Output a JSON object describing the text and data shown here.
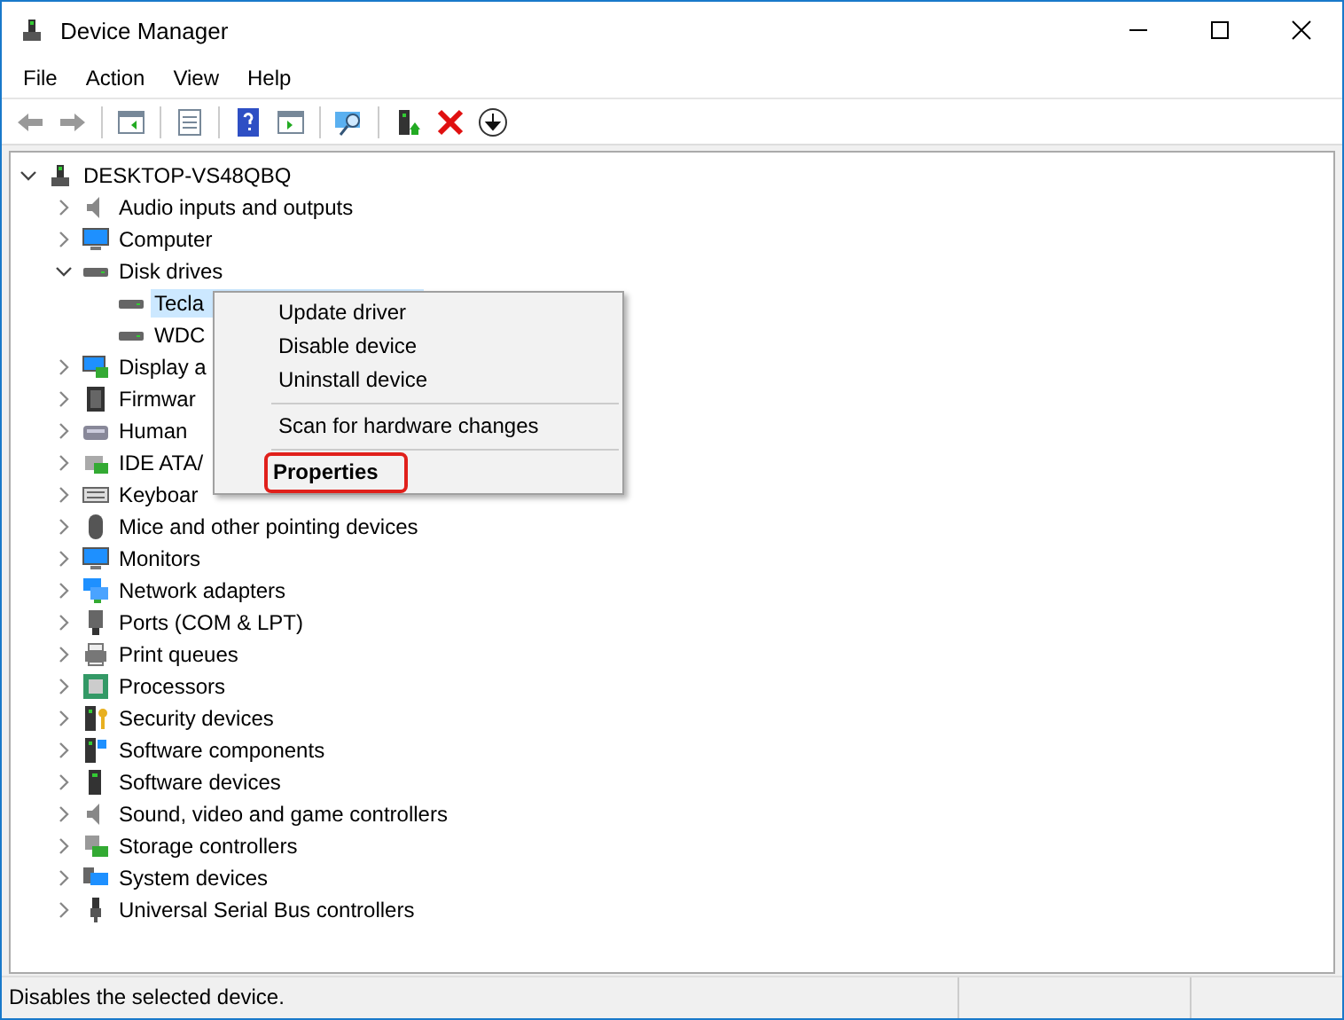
{
  "window": {
    "title": "Device Manager"
  },
  "menu_bar": [
    "File",
    "Action",
    "View",
    "Help"
  ],
  "tree": [
    {
      "label": "DESKTOP-VS48QBQ",
      "expanded": true,
      "selected": false,
      "children": [
        {
          "label": "Audio inputs and outputs",
          "expanded": false,
          "selected": false
        },
        {
          "label": "Computer",
          "expanded": false,
          "selected": false
        },
        {
          "label": "Disk drives",
          "expanded": true,
          "selected": false,
          "children": [
            {
              "label": "Tecla",
              "selected": true
            },
            {
              "label": "WDC",
              "selected": false
            }
          ]
        },
        {
          "label": "Display a",
          "expanded": false,
          "selected": false
        },
        {
          "label": "Firmwar",
          "expanded": false,
          "selected": false
        },
        {
          "label": "Human",
          "expanded": false,
          "selected": false
        },
        {
          "label": "IDE ATA/",
          "expanded": false,
          "selected": false
        },
        {
          "label": "Keyboar",
          "expanded": false,
          "selected": false
        },
        {
          "label": "Mice and other pointing devices",
          "expanded": false,
          "selected": false
        },
        {
          "label": "Monitors",
          "expanded": false,
          "selected": false
        },
        {
          "label": "Network adapters",
          "expanded": false,
          "selected": false
        },
        {
          "label": "Ports (COM & LPT)",
          "expanded": false,
          "selected": false
        },
        {
          "label": "Print queues",
          "expanded": false,
          "selected": false
        },
        {
          "label": "Processors",
          "expanded": false,
          "selected": false
        },
        {
          "label": "Security devices",
          "expanded": false,
          "selected": false
        },
        {
          "label": "Software components",
          "expanded": false,
          "selected": false
        },
        {
          "label": "Software devices",
          "expanded": false,
          "selected": false
        },
        {
          "label": "Sound, video and game controllers",
          "expanded": false,
          "selected": false
        },
        {
          "label": "Storage controllers",
          "expanded": false,
          "selected": false
        },
        {
          "label": "System devices",
          "expanded": false,
          "selected": false
        },
        {
          "label": "Universal Serial Bus controllers",
          "expanded": false,
          "selected": false
        }
      ]
    }
  ],
  "context_menu": [
    {
      "kind": "item",
      "label": "Update driver",
      "highlighted": false
    },
    {
      "kind": "item",
      "label": "Disable device",
      "highlighted": false
    },
    {
      "kind": "item",
      "label": "Uninstall device",
      "highlighted": false
    },
    {
      "kind": "separator"
    },
    {
      "kind": "item",
      "label": "Scan for hardware changes",
      "highlighted": false
    },
    {
      "kind": "separator"
    },
    {
      "kind": "item",
      "label": "Properties",
      "highlighted": true
    }
  ],
  "status_bar": {
    "text": "Disables the selected device."
  }
}
